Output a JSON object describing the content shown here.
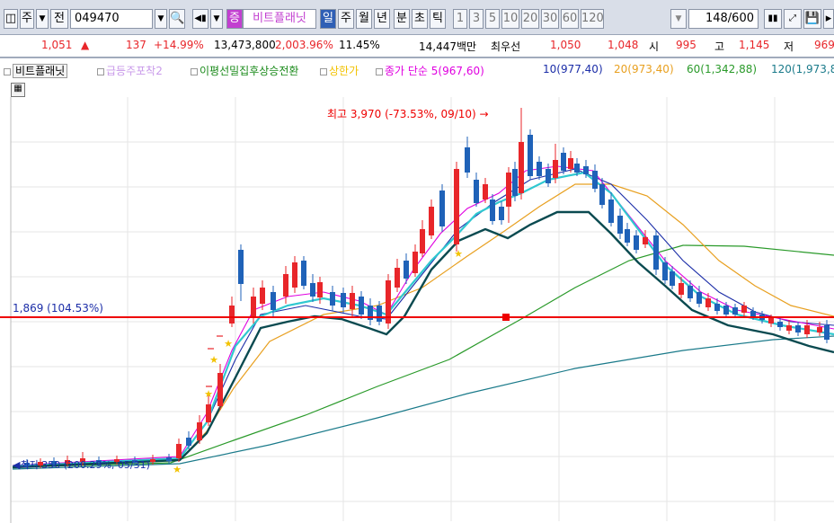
{
  "toolbar": {
    "market_code": "주",
    "prev_label": "전",
    "stock_code": "049470",
    "indicator_label": "증",
    "stock_name": "비트플래닛",
    "periods": [
      "일",
      "주",
      "월",
      "년",
      "분",
      "초",
      "틱"
    ],
    "minute_options": [
      "1",
      "3",
      "5",
      "10",
      "20",
      "30",
      "60",
      "120"
    ],
    "count_value": "148",
    "count_total": "/600"
  },
  "quote": {
    "price": "1,051",
    "change_arrow": "▲",
    "change": "137",
    "change_pct": "+14.99%",
    "volume": "13,473,800",
    "volume_pct": "2,003.96%",
    "turnover": "11.45%",
    "amount": "14,447백만",
    "best_label": "최우선",
    "ask": "1,050",
    "bid": "1,048",
    "open_label": "시",
    "open": "995",
    "high_label": "고",
    "high": "1,145",
    "low_label": "저",
    "low": "969"
  },
  "legend": {
    "items": [
      {
        "text": "비트플래닛",
        "color": "#000000"
      },
      {
        "text": "급등주포착2",
        "color": "#c99aea"
      },
      {
        "text": "이평선밀집후상승전환",
        "color": "#1a8a1a"
      },
      {
        "text": "상한가",
        "color": "#f2c200"
      },
      {
        "text": "종가 단순 5(967,60)",
        "color": "#e000e0"
      },
      {
        "text": "10(977,40)",
        "color": "#1c2ea8"
      },
      {
        "text": "20(973,40)",
        "color": "#e8a020"
      },
      {
        "text": "60(1,342,88)",
        "color": "#2a9a2a"
      },
      {
        "text": "120(1,973,8",
        "color": "#1a7a8a"
      }
    ]
  },
  "annotations": {
    "max_label": "최고 3,970 (-73.53%, 09/10) →",
    "hline_label": "1,869 (104.53%)",
    "min_label": "◀최저 350 (200.29%, 05/31)"
  },
  "colors": {
    "up": "#e8262a",
    "down": "#1f62b8",
    "ma5": "#e000e0",
    "ma10": "#1c2ea8",
    "ma20": "#e8a020",
    "ma60": "#2a9a2a",
    "ma120": "#1a7a8a",
    "cyan": "#30c8d0",
    "dark": "#0a4a50",
    "hline": "#ee0000"
  },
  "chart_data": {
    "type": "candlestick",
    "price_scale_reference_lines": [
      1869
    ],
    "max_marker": {
      "value": 3970,
      "date": "09/10"
    },
    "min_marker": {
      "value": 350,
      "date": "05/31"
    }
  }
}
